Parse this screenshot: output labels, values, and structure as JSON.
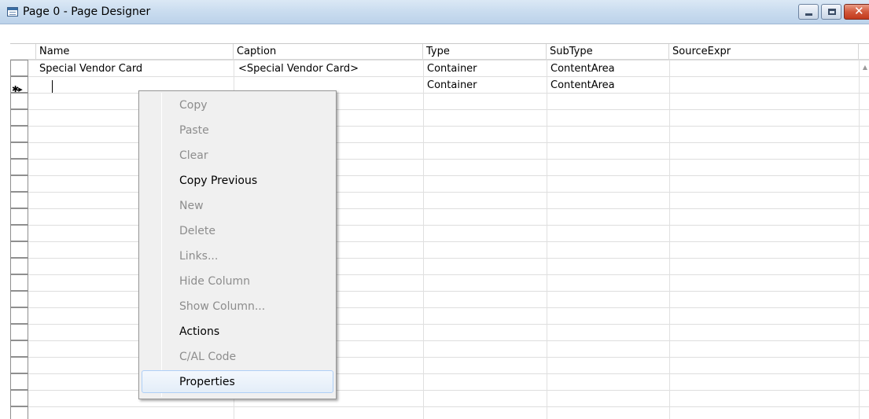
{
  "window": {
    "title": "Page 0 - Page Designer"
  },
  "grid": {
    "columns": [
      "Name",
      "Caption",
      "Type",
      "SubType",
      "SourceExpr"
    ],
    "rows": [
      {
        "name": "Special Vendor Card",
        "caption": "<Special Vendor Card>",
        "type": "Container",
        "subtype": "ContentArea",
        "sourceexpr": ""
      },
      {
        "name": "",
        "caption": "",
        "type": "Container",
        "subtype": "ContentArea",
        "sourceexpr": ""
      }
    ],
    "new_row_marker": "✱▸"
  },
  "context_menu": {
    "items": [
      {
        "label": "Copy",
        "enabled": false
      },
      {
        "label": "Paste",
        "enabled": false
      },
      {
        "label": "Clear",
        "enabled": false
      },
      {
        "label": "Copy Previous",
        "enabled": true
      },
      {
        "label": "New",
        "enabled": false
      },
      {
        "label": "Delete",
        "enabled": false
      },
      {
        "label": "Links...",
        "enabled": false
      },
      {
        "label": "Hide Column",
        "enabled": false
      },
      {
        "label": "Show Column...",
        "enabled": false
      },
      {
        "label": "Actions",
        "enabled": true
      },
      {
        "label": "C/AL Code",
        "enabled": false
      },
      {
        "label": "Properties",
        "enabled": true,
        "highlighted": true
      }
    ]
  }
}
